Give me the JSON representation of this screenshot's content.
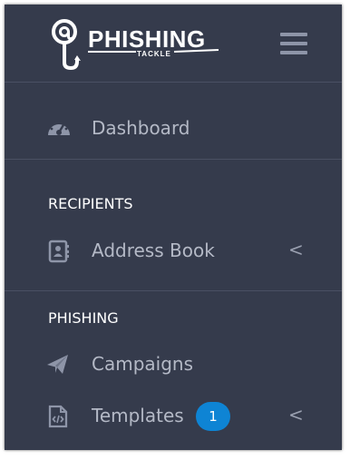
{
  "brand": {
    "logo_text": "PHISHING",
    "logo_subtext": "TACKLE"
  },
  "nav": {
    "dashboard_label": "Dashboard",
    "recipients_header": "RECIPIENTS",
    "address_book_label": "Address Book",
    "phishing_header": "PHISHING",
    "campaigns_label": "Campaigns",
    "templates_label": "Templates",
    "templates_badge": "1",
    "chevron": "<"
  },
  "colors": {
    "sidebar_bg": "#353b4c",
    "badge": "#0e84d4"
  },
  "icons": {
    "menu": "hamburger-menu-icon",
    "dashboard": "speedometer-icon",
    "address_book": "address-book-icon",
    "campaigns": "paper-plane-icon",
    "templates": "code-file-icon"
  }
}
